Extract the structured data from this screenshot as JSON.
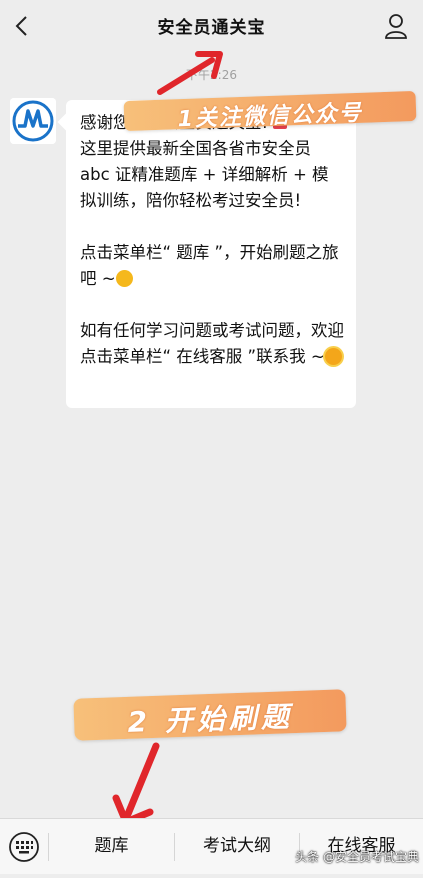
{
  "header": {
    "title": "安全员通关宝",
    "back_icon": "chevron-left-icon",
    "profile_icon": "user-icon"
  },
  "chat": {
    "timestamp": "下午2:26",
    "message": {
      "line1": "感谢您关注安全员通关宝!",
      "line2": "这里提供最新全国各省市安全员 abc 证精准题库 + 详细解析 + 模拟训练，陪你轻松考过安全员!",
      "line3": "点击菜单栏“ 题库 ”，开始刷题之旅吧 ~",
      "line4": "如有任何学习问题或考试问题，欢迎点击菜单栏“ 在线客服 ”联系我 ~"
    }
  },
  "annotations": {
    "step1": "1关注微信公众号",
    "step2": "2 开始刷题"
  },
  "menu": {
    "keyboard_icon": "keyboard-icon",
    "items": [
      "题库",
      "考试大纲",
      "在线客服"
    ]
  },
  "watermark": "头条 @安全员考试宝典",
  "colors": {
    "annotation": "#f3a066",
    "arrow": "#e0262b",
    "logo": "#1a73c9"
  }
}
